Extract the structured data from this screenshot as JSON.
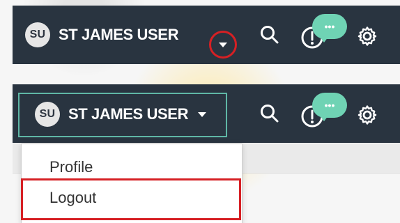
{
  "panel1": {
    "avatar_initials": "SU",
    "user_name": "ST JAMES USER",
    "dropdown_caret_icon": "chevron-down-icon",
    "search_icon": "search-icon",
    "notifications_icon": "notification-icon",
    "chat_icon": "chat-bubble-icon",
    "chat_bubble_text": "•••",
    "settings_icon": "gear-icon",
    "highlight_color": "#d62024"
  },
  "panel2": {
    "avatar_initials": "SU",
    "user_name": "ST JAMES USER",
    "dropdown_caret_icon": "chevron-down-icon",
    "search_icon": "search-icon",
    "notifications_icon": "notification-icon",
    "chat_icon": "chat-bubble-icon",
    "chat_bubble_text": "•••",
    "settings_icon": "gear-icon",
    "focus_color": "#5fb7a6",
    "menu": {
      "items": [
        {
          "label": "Profile"
        },
        {
          "label": "Logout"
        }
      ],
      "highlight_color": "#d62024"
    }
  },
  "colors": {
    "header_bg": "#293440",
    "chat_bubble": "#6fd3b4",
    "text_on_dark": "#ffffff",
    "menu_text": "#333333"
  }
}
